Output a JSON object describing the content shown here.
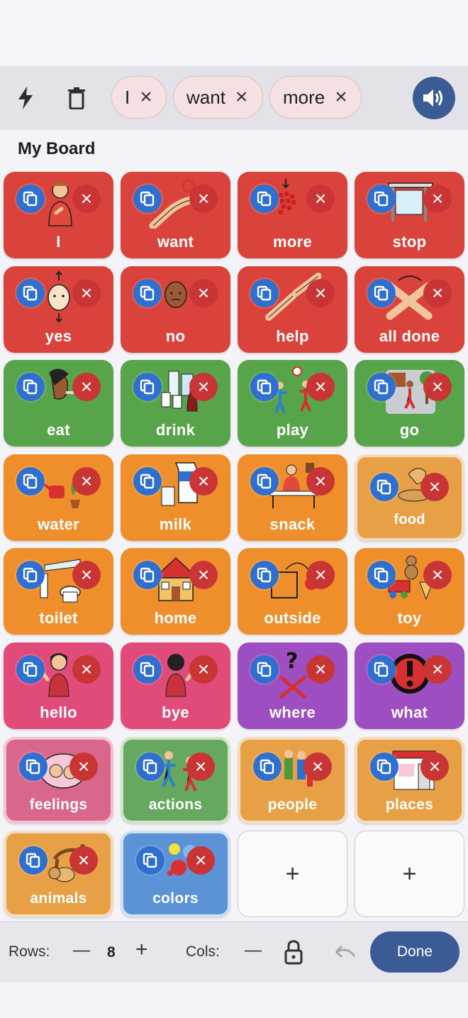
{
  "sentence": {
    "chips": [
      {
        "label": "I"
      },
      {
        "label": "want"
      },
      {
        "label": "more"
      }
    ],
    "chip_remove_glyph": "×"
  },
  "board": {
    "title": "My Board",
    "tiles": [
      {
        "label": "I"
      },
      {
        "label": "want"
      },
      {
        "label": "more"
      },
      {
        "label": "stop"
      },
      {
        "label": "yes"
      },
      {
        "label": "no"
      },
      {
        "label": "help"
      },
      {
        "label": "all done"
      },
      {
        "label": "eat"
      },
      {
        "label": "drink"
      },
      {
        "label": "play"
      },
      {
        "label": "go"
      },
      {
        "label": "water"
      },
      {
        "label": "milk"
      },
      {
        "label": "snack"
      },
      {
        "label": "food"
      },
      {
        "label": "toilet"
      },
      {
        "label": "home"
      },
      {
        "label": "outside"
      },
      {
        "label": "toy"
      },
      {
        "label": "hello"
      },
      {
        "label": "bye"
      },
      {
        "label": "where"
      },
      {
        "label": "what"
      },
      {
        "label": "feelings"
      },
      {
        "label": "actions"
      },
      {
        "label": "people"
      },
      {
        "label": "places"
      },
      {
        "label": "animals"
      },
      {
        "label": "colors"
      }
    ],
    "delete_glyph": "×",
    "add_glyph": "+"
  },
  "footer": {
    "rows_label": "Rows:",
    "rows_value": "8",
    "cols_label": "Cols:",
    "minus_glyph": "—",
    "plus_glyph": "+",
    "done_label": "Done"
  },
  "colors": {
    "core_red": "#d9433b",
    "verb_green": "#58a44b",
    "noun_orange": "#ef8f2c",
    "social_pink": "#e14b7a",
    "question_purple": "#9d4ec0",
    "accent_blue": "#3b5b94"
  }
}
